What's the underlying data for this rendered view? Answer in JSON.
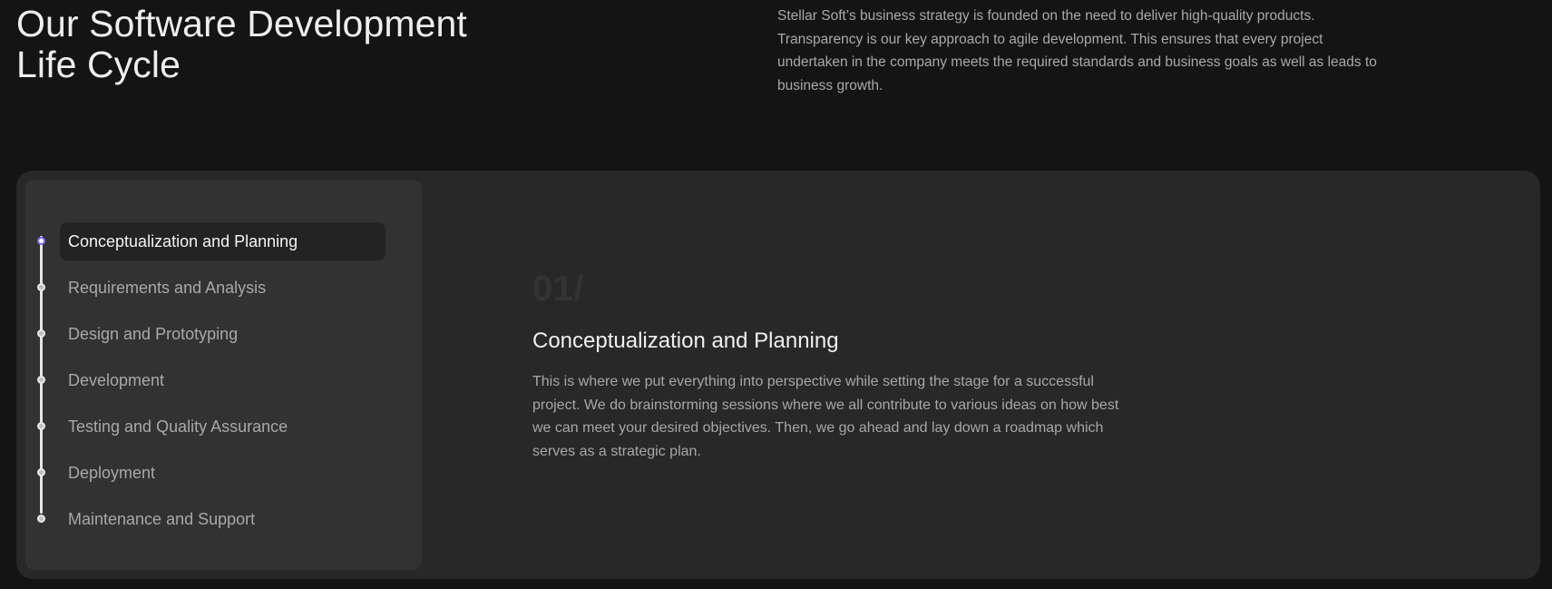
{
  "header": {
    "title": "Our Software Development Life Cycle",
    "intro": "Stellar Soft’s business strategy is founded on the need to deliver high-quality products. Transparency is our key approach to agile development. This ensures that every project undertaken in the company meets the required standards and business goals as well as leads to business growth."
  },
  "lifecycle": {
    "steps": [
      {
        "label": "Conceptualization and Planning",
        "active": true
      },
      {
        "label": "Requirements and Analysis",
        "active": false
      },
      {
        "label": "Design and Prototyping",
        "active": false
      },
      {
        "label": "Development",
        "active": false
      },
      {
        "label": "Testing and Quality Assurance",
        "active": false
      },
      {
        "label": "Deployment",
        "active": false
      },
      {
        "label": "Maintenance and Support",
        "active": false
      }
    ],
    "detail": {
      "number": "01/",
      "title": "Conceptualization and Planning",
      "text": "This is where we put everything into perspective while setting the stage for a successful project. We do brainstorming sessions where we all contribute to various ideas on how best we can meet your desired objectives. Then, we go ahead and lay down a roadmap which serves as a strategic plan."
    }
  },
  "colors": {
    "background": "#141414",
    "card": "#282828",
    "panel": "#323232",
    "active_pill": "#232323",
    "accent": "#7b6cf6"
  }
}
